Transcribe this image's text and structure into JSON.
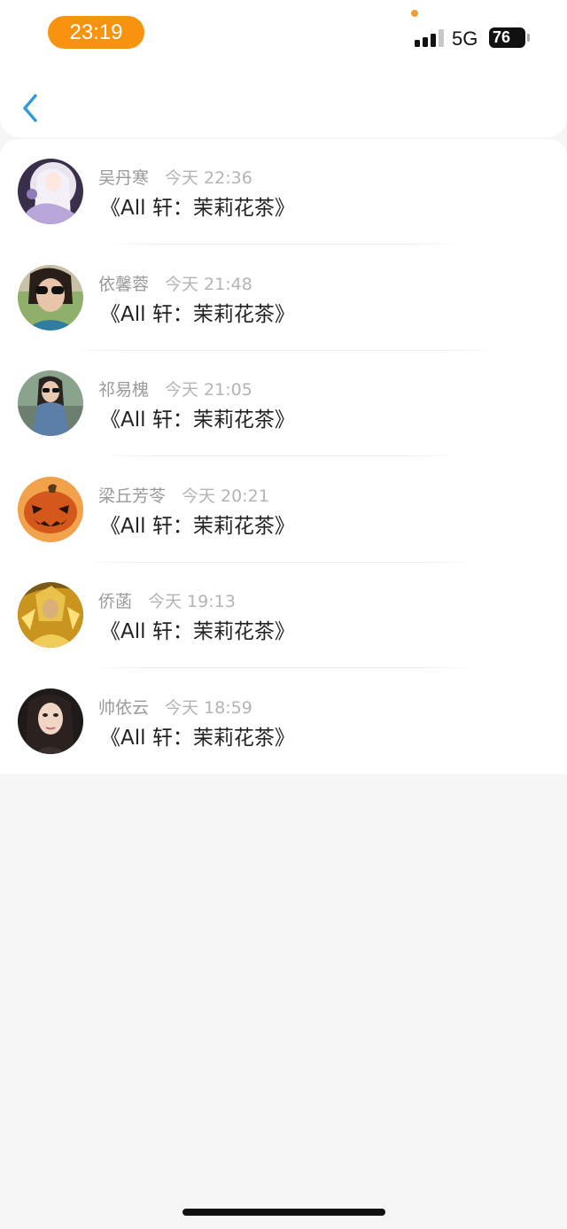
{
  "status_bar": {
    "time": "23:19",
    "network": "5G",
    "battery": "76"
  },
  "colors": {
    "accent": "#2f9bd8",
    "time_pill": "#f7930e"
  },
  "header": {
    "back_icon": "chevron-left-icon"
  },
  "items": [
    {
      "name": "吴丹寒",
      "time": "今天 22:36",
      "title": "《All 轩：茉莉花茶》",
      "avatar": "anime-girl-avatar"
    },
    {
      "name": "依馨蓉",
      "time": "今天 21:48",
      "title": "《All 轩：茉莉花茶》",
      "avatar": "sunglasses-woman-avatar"
    },
    {
      "name": "祁易槐",
      "time": "今天 21:05",
      "title": "《All 轩：茉莉花茶》",
      "avatar": "sitting-woman-avatar"
    },
    {
      "name": "梁丘芳苓",
      "time": "今天 20:21",
      "title": "《All 轩：茉莉花茶》",
      "avatar": "pumpkin-avatar"
    },
    {
      "name": "侨菡",
      "time": "今天 19:13",
      "title": "《All 轩：茉莉花茶》",
      "avatar": "golden-warrior-avatar"
    },
    {
      "name": "帅依云",
      "time": "今天 18:59",
      "title": "《All 轩：茉莉花茶》",
      "avatar": "woman-portrait-avatar"
    }
  ]
}
